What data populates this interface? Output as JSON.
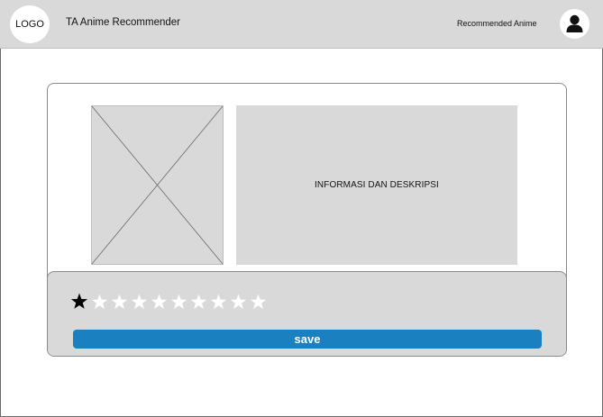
{
  "header": {
    "logo_text": "LOGO",
    "app_title": "TA Anime Recommender",
    "nav_link": "Recommended Anime",
    "avatar_icon": "user-icon"
  },
  "main": {
    "poster_icon": "image-placeholder-icon",
    "info_text": "INFORMASI DAN DESKRIPSI",
    "rating": {
      "value": 1,
      "max": 10,
      "filled_color": "#000000",
      "empty_color": "#ffffff"
    },
    "save_label": "save",
    "save_color": "#1b80c0"
  }
}
